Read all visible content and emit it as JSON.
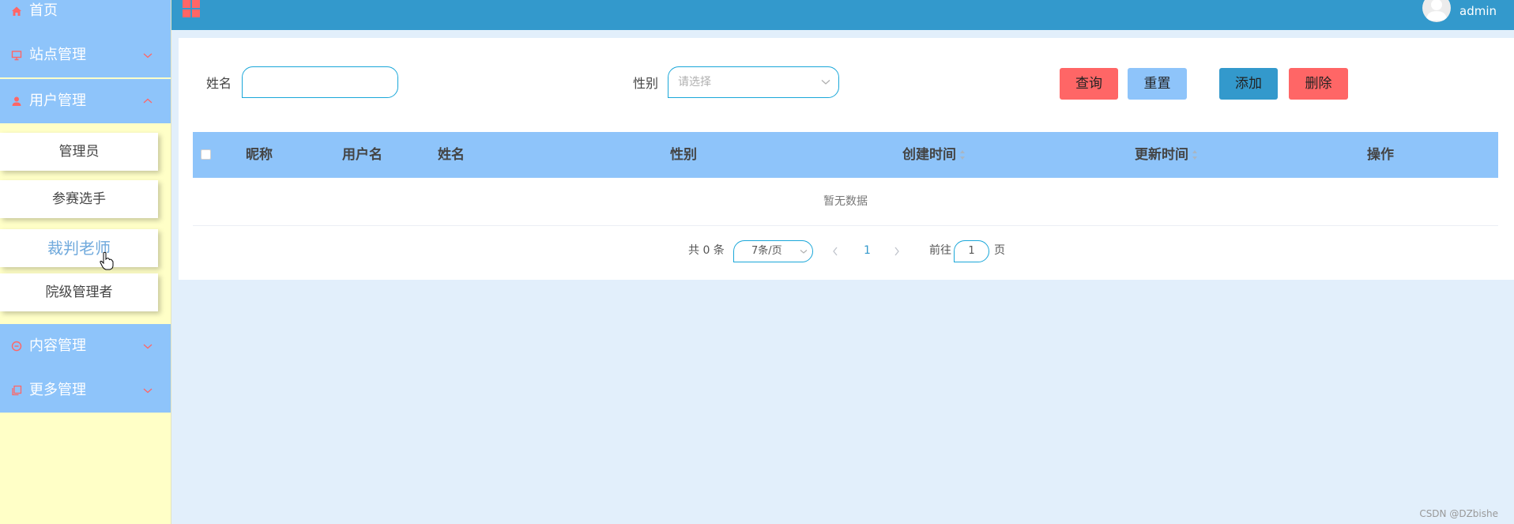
{
  "sidebar": {
    "home_label": "首页",
    "site_label": "站点管理",
    "user_label": "用户管理",
    "sub_items": [
      "管理员",
      "参赛选手",
      "裁判老师",
      "院级管理者"
    ],
    "content_label": "内容管理",
    "more_label": "更多管理"
  },
  "header": {
    "username": "admin"
  },
  "search": {
    "name_label": "姓名",
    "name_value": "",
    "gender_label": "性别",
    "gender_placeholder": "请选择",
    "query_label": "查询",
    "reset_label": "重置",
    "add_label": "添加",
    "delete_label": "删除"
  },
  "table": {
    "columns": [
      "昵称",
      "用户名",
      "姓名",
      "性别",
      "创建时间",
      "更新时间",
      "操作"
    ],
    "empty_text": "暂无数据"
  },
  "pagination": {
    "total_text": "共 0 条",
    "page_size": "7条/页",
    "current_page": "1",
    "goto_label": "前往",
    "goto_value": "1",
    "page_suffix": "页"
  },
  "watermark": "CSDN @DZbishe",
  "colors": {
    "sidebar_menu_bg": "#8ec4fa",
    "sidebar_bg": "#ffffc7",
    "topbar_bg": "#3399cc",
    "accent_red": "#ff6666",
    "accent_blue": "#8ec4fa",
    "add_blue": "#3399cc",
    "content_bg": "#e2effb"
  },
  "icons": {
    "home": "home-icon",
    "site": "monitor-icon",
    "user": "user-icon",
    "content": "message-icon",
    "more": "copy-icon",
    "grid": "grid-icon",
    "avatar": "avatar-icon",
    "cursor": "hand-cursor-icon"
  }
}
